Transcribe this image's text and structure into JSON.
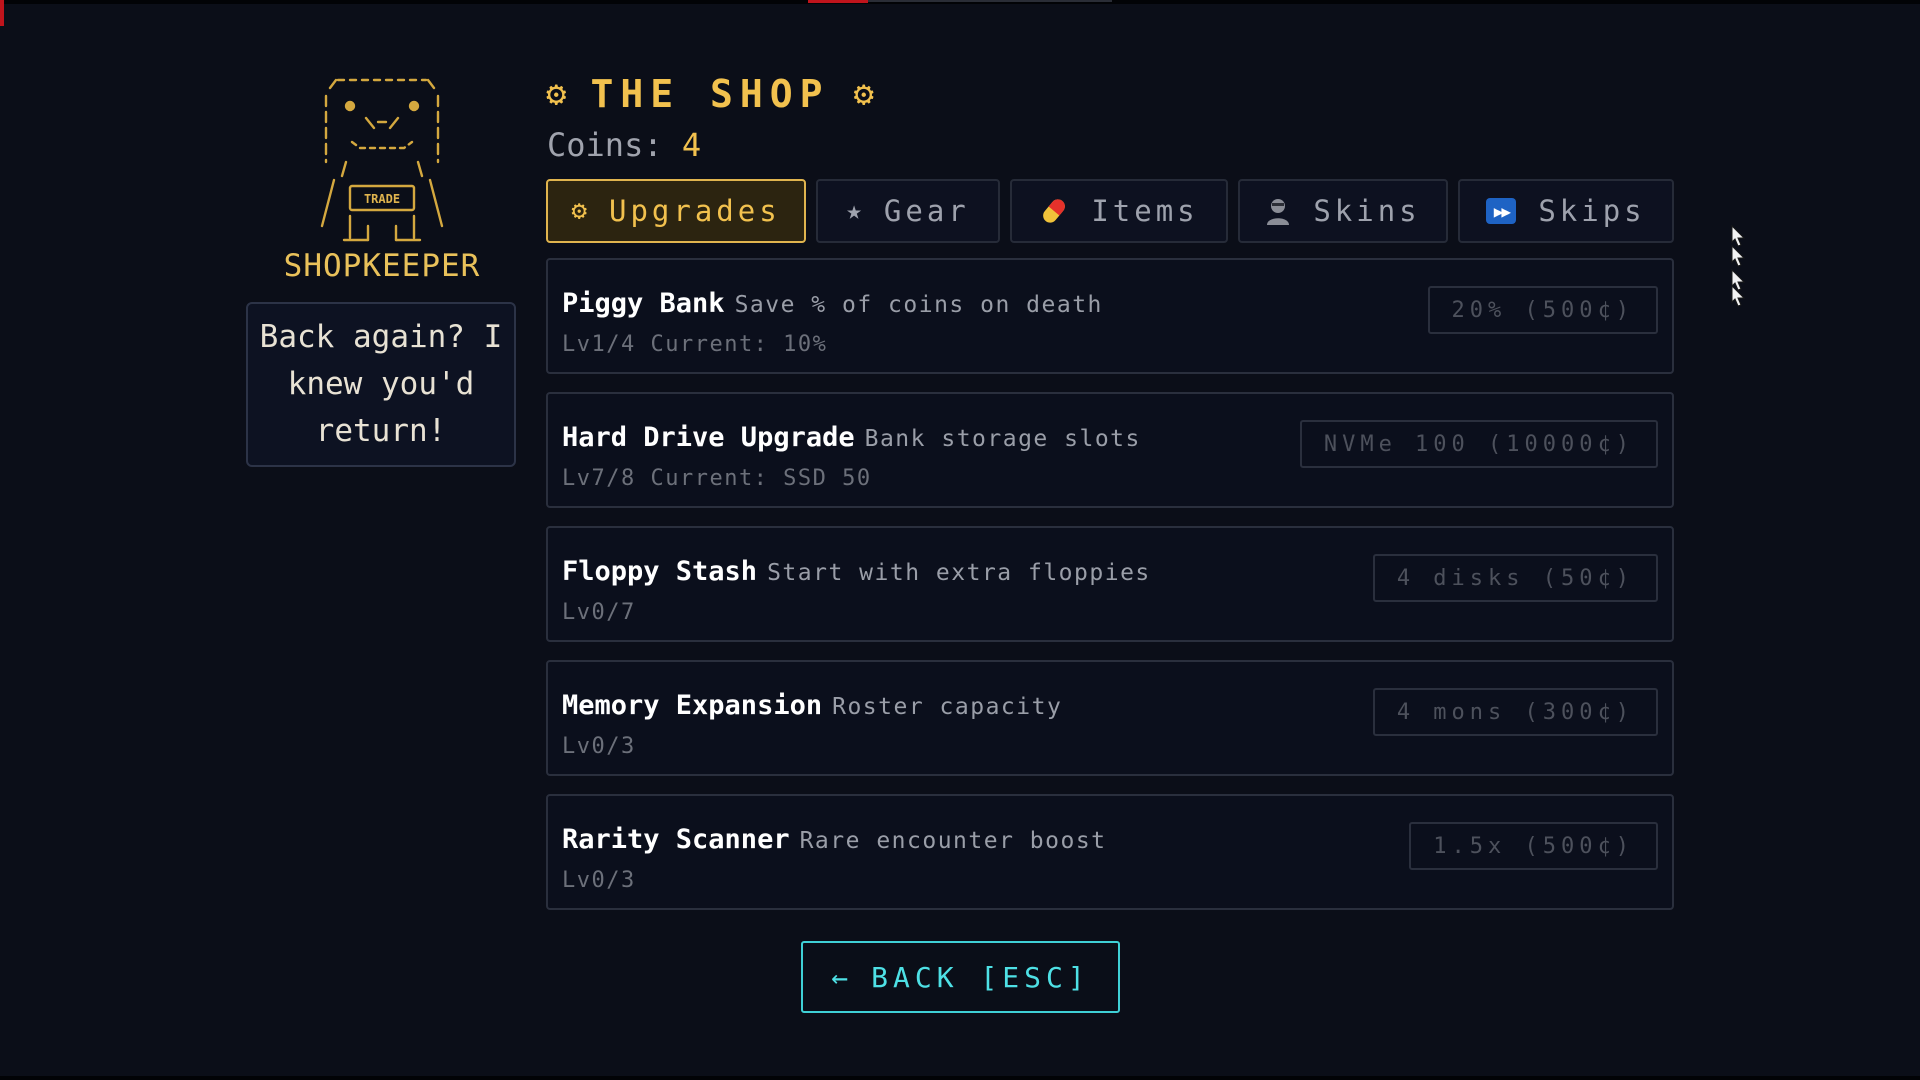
{
  "shopkeeper": {
    "name": "SHOPKEEPER",
    "art_sign": "TRADE",
    "speech": "Back again? I knew you'd return!"
  },
  "shop": {
    "title": "THE SHOP",
    "coins_label": "Coins:",
    "coins_value": "4"
  },
  "tabs": [
    {
      "label": "Upgrades",
      "icon": "gear-icon",
      "active": true
    },
    {
      "label": "Gear",
      "icon": "star-icon",
      "active": false
    },
    {
      "label": "Items",
      "icon": "pill-icon",
      "active": false
    },
    {
      "label": "Skins",
      "icon": "person-icon",
      "active": false
    },
    {
      "label": "Skips",
      "icon": "fast-forward-icon",
      "active": false
    }
  ],
  "items": [
    {
      "name": "Piggy Bank",
      "desc": "Save % of coins on death",
      "level": "Lv1/4 Current: 10%",
      "price": "20% (500¢)"
    },
    {
      "name": "Hard Drive Upgrade",
      "desc": "Bank storage slots",
      "level": "Lv7/8 Current: SSD 50",
      "price": "NVMe 100 (10000¢)"
    },
    {
      "name": "Floppy Stash",
      "desc": "Start with extra floppies",
      "level": "Lv0/7",
      "price": "4 disks (50¢)"
    },
    {
      "name": "Memory Expansion",
      "desc": "Roster capacity",
      "level": "Lv0/3",
      "price": "4 mons (300¢)"
    },
    {
      "name": "Rarity Scanner",
      "desc": "Rare encounter boost",
      "level": "Lv0/3",
      "price": "1.5x (500¢)"
    }
  ],
  "back": {
    "arrow": "←",
    "label": "BACK [ESC]"
  },
  "colors": {
    "background": "#0b0e18",
    "accent_gold": "#f2c14e",
    "accent_cyan": "#4ee0e5",
    "panel_border": "#2a2f3d"
  }
}
